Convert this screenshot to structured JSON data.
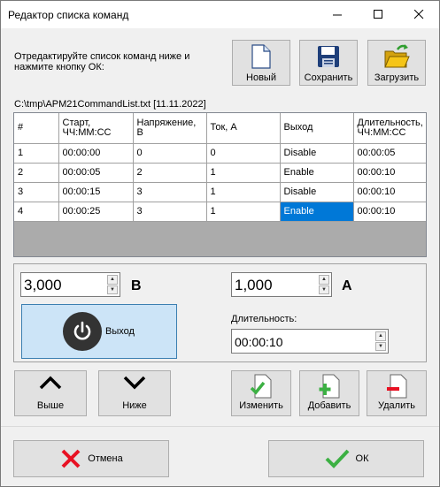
{
  "window": {
    "title": "Редактор списка команд",
    "controls": [
      "minimize",
      "maximize",
      "close"
    ]
  },
  "instructions": "Отредактируйте список команд ниже и нажмите кнопку ОК:",
  "toolbar": {
    "new_label": "Новый",
    "save_label": "Сохранить",
    "load_label": "Загрузить"
  },
  "file_path": "C:\\tmp\\APM21CommandList.txt [11.11.2022]",
  "table": {
    "columns": [
      "#",
      "Старт,\nЧЧ:ММ:СС",
      "Напряжение,\nВ",
      "Ток, А",
      "Выход",
      "Длительность,\nЧЧ:ММ:СС"
    ],
    "rows": [
      [
        "1",
        "00:00:00",
        "0",
        "0",
        "Disable",
        "00:00:05"
      ],
      [
        "2",
        "00:00:05",
        "2",
        "1",
        "Enable",
        "00:00:10"
      ],
      [
        "3",
        "00:00:15",
        "3",
        "1",
        "Disable",
        "00:00:10"
      ],
      [
        "4",
        "00:00:25",
        "3",
        "1",
        "Enable",
        "00:00:10"
      ]
    ],
    "selected_cell": {
      "row": 3,
      "col": 4
    }
  },
  "editor": {
    "voltage_value": "3,000",
    "voltage_unit": "В",
    "current_value": "1,000",
    "current_unit": "А",
    "output_button_label": "Выход",
    "duration_label": "Длительность:",
    "duration_value": "00:00:10"
  },
  "actions": {
    "up_label": "Выше",
    "down_label": "Ниже",
    "edit_label": "Изменить",
    "add_label": "Добавить",
    "delete_label": "Удалить"
  },
  "dialog": {
    "cancel_label": "Отмена",
    "ok_label": "ОК"
  },
  "colors": {
    "selection": "#0078d7",
    "output_button": "#cce4f7",
    "cancel_icon": "#e81123",
    "ok_icon": "#3cb043",
    "folder": "#f5c518"
  }
}
